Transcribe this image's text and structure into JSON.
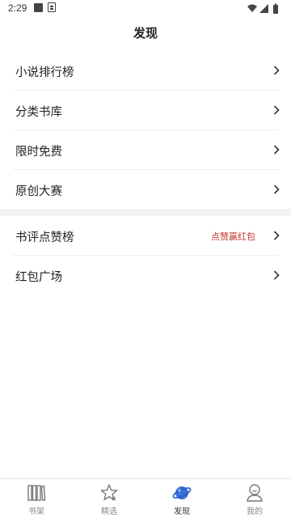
{
  "status_bar": {
    "time": "2:29"
  },
  "header": {
    "title": "发现"
  },
  "menu": {
    "items": [
      {
        "label": "小说排行榜",
        "icon": "chevron-right-icon"
      },
      {
        "label": "分类书库",
        "icon": "chevron-right-icon"
      },
      {
        "label": "限时免费",
        "icon": "chevron-right-icon"
      },
      {
        "label": "原创大赛",
        "icon": "chevron-right-icon"
      }
    ],
    "items2": [
      {
        "label": "书评点赞榜",
        "badge": "点赞赢红包",
        "icon": "chevron-right-icon"
      },
      {
        "label": "红包广场",
        "icon": "chevron-right-icon"
      }
    ]
  },
  "bottom_nav": {
    "active_index": 2,
    "active_color": "#3a6fd8",
    "items": [
      {
        "label": "书架",
        "icon": "bookshelf-icon"
      },
      {
        "label": "精选",
        "icon": "star-icon"
      },
      {
        "label": "发现",
        "icon": "planet-icon"
      },
      {
        "label": "我的",
        "icon": "person-icon"
      }
    ]
  },
  "colors": {
    "badge": "#c0392b",
    "text": "#222222",
    "nav_inactive": "#888888"
  }
}
